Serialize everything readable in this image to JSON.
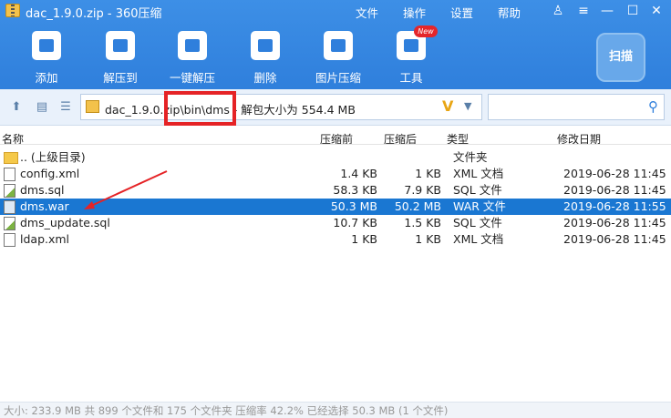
{
  "window": {
    "title": "dac_1.9.0.zip - 360压缩",
    "menus": [
      "文件",
      "操作",
      "设置",
      "帮助"
    ]
  },
  "toolbar": {
    "buttons": [
      {
        "label": "添加",
        "icon": "add-icon"
      },
      {
        "label": "解压到",
        "icon": "extract-to-icon"
      },
      {
        "label": "一键解压",
        "icon": "one-click-extract-icon"
      },
      {
        "label": "删除",
        "icon": "delete-icon"
      },
      {
        "label": "图片压缩",
        "icon": "image-compress-icon"
      },
      {
        "label": "工具",
        "icon": "tools-icon"
      }
    ],
    "new_badge": "New",
    "scan_label": "扫描"
  },
  "address": {
    "path": "dac_1.9.0.zip\\bin\\dms - 解包大小为 554.4 MB",
    "search_placeholder": ""
  },
  "columns": [
    "名称",
    "压缩前",
    "压缩后",
    "类型",
    "修改日期"
  ],
  "files": [
    {
      "name": ".. (上级目录)",
      "packed": "",
      "size": "",
      "type": "文件夹",
      "date": "",
      "icon": "folder"
    },
    {
      "name": "config.xml",
      "packed": "1.4 KB",
      "size": "1 KB",
      "type": "XML 文档",
      "date": "2019-06-28 11:45",
      "icon": "xml"
    },
    {
      "name": "dms.sql",
      "packed": "58.3 KB",
      "size": "7.9 KB",
      "type": "SQL 文件",
      "date": "2019-06-28 11:45",
      "icon": "sql"
    },
    {
      "name": "dms.war",
      "packed": "50.3 MB",
      "size": "50.2 MB",
      "type": "WAR 文件",
      "date": "2019-06-28 11:55",
      "icon": "war",
      "selected": true
    },
    {
      "name": "dms_update.sql",
      "packed": "10.7 KB",
      "size": "1.5 KB",
      "type": "SQL 文件",
      "date": "2019-06-28 11:45",
      "icon": "sql"
    },
    {
      "name": "ldap.xml",
      "packed": "1 KB",
      "size": "1 KB",
      "type": "XML 文档",
      "date": "2019-06-28 11:45",
      "icon": "xml"
    }
  ],
  "status": "大小: 233.9 MB 共 899 个文件和 175 个文件夹 压缩率 42.2% 已经选择 50.3 MB (1 个文件)",
  "colors": {
    "accent": "#2f7fdc",
    "selection": "#1a77d2",
    "annotation": "#e52326"
  }
}
